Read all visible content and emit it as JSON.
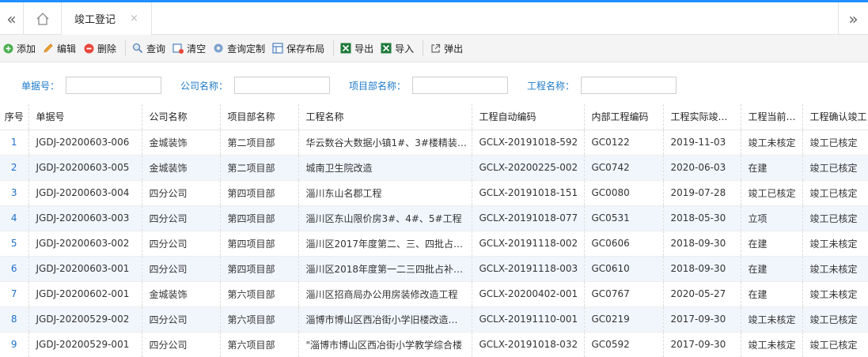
{
  "tabbar": {
    "active_tab": "竣工登记",
    "close": "×",
    "prev": "«",
    "next": "»"
  },
  "toolbar": {
    "add": "添加",
    "edit": "编辑",
    "delete": "删除",
    "query": "查询",
    "clear": "清空",
    "query_custom": "查询定制",
    "save_layout": "保存布局",
    "export": "导出",
    "import": "导入",
    "popup": "弹出"
  },
  "search": {
    "doc_no": "单据号：",
    "company": "公司名称：",
    "dept": "项目部名称：",
    "project": "工程名称："
  },
  "columns": [
    "序号",
    "单据号",
    "公司名称",
    "项目部名称",
    "工程名称",
    "工程自动编码",
    "内部工程编码",
    "工程实际竣…",
    "工程当前…",
    "工程确认竣工"
  ],
  "rows": [
    [
      "1",
      "JGDJ-20200603-006",
      "金城装饰",
      "第二项目部",
      "华云数谷大数据小镇1#、3#楼精装…",
      "GCLX-20191018-592",
      "GC0122",
      "2019-11-03",
      "竣工未核定",
      "竣工已核定"
    ],
    [
      "2",
      "JGDJ-20200603-005",
      "金城装饰",
      "第二项目部",
      "城南卫生院改造",
      "GCLX-20200225-002",
      "GC0742",
      "2020-06-03",
      "在建",
      "竣工已核定"
    ],
    [
      "3",
      "JGDJ-20200603-004",
      "四分公司",
      "第四项目部",
      "淄川东山名郡工程",
      "GCLX-20191018-151",
      "GC0080",
      "2019-07-28",
      "竣工已核定",
      "竣工已核定"
    ],
    [
      "4",
      "JGDJ-20200603-003",
      "四分公司",
      "第四项目部",
      "淄川区东山限价房3#、4#、5#工程",
      "GCLX-20191018-077",
      "GC0531",
      "2018-05-30",
      "立项",
      "竣工已核定"
    ],
    [
      "5",
      "JGDJ-20200603-002",
      "四分公司",
      "第四项目部",
      "淄川区2017年度第二、三、四批占…",
      "GCLX-20191118-002",
      "GC0606",
      "2018-09-30",
      "在建",
      "竣工未核定"
    ],
    [
      "6",
      "JGDJ-20200603-001",
      "四分公司",
      "第四项目部",
      "淄川区2018年度第一二三四批占补…",
      "GCLX-20191118-003",
      "GC0610",
      "2018-09-30",
      "在建",
      "竣工未核定"
    ],
    [
      "7",
      "JGDJ-20200602-001",
      "金城装饰",
      "第六项目部",
      "淄川区招商局办公用房装修改造工程",
      "GCLX-20200402-001",
      "GC0767",
      "2020-05-27",
      "在建",
      "竣工未核定"
    ],
    [
      "8",
      "JGDJ-20200529-002",
      "四分公司",
      "第六项目部",
      "淄博市博山区西冶街小学旧楼改造…",
      "GCLX-20191110-001",
      "GC0219",
      "2017-09-30",
      "竣工未核定",
      "竣工已核定"
    ],
    [
      "9",
      "JGDJ-20200529-001",
      "四分公司",
      "第六项目部",
      "\"淄博市博山区西冶街小学教学综合楼",
      "GCLX-20191018-032",
      "GC0592",
      "2017-09-30",
      "竣工未核定",
      "竣工已核定"
    ]
  ]
}
